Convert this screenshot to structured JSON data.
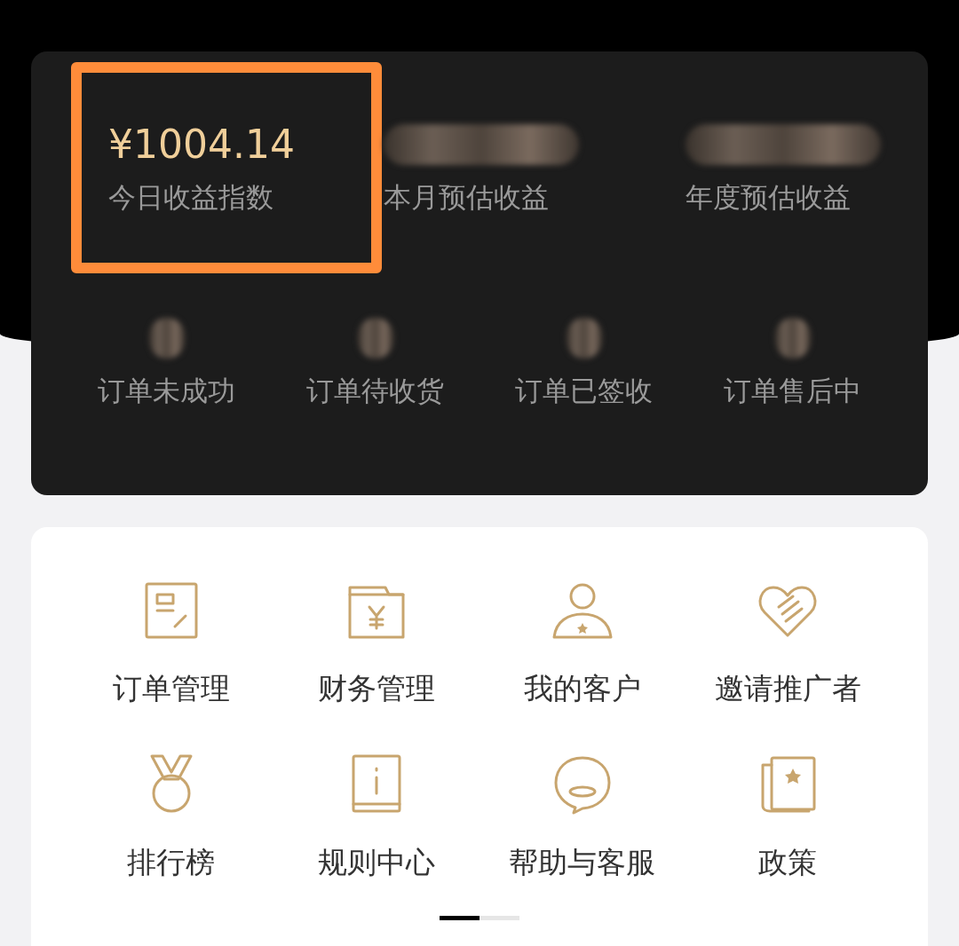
{
  "summary": {
    "stats": [
      {
        "value": "¥1004.14",
        "label": "今日收益指数",
        "highlighted": true
      },
      {
        "label": "本月预估收益",
        "highlighted": false
      },
      {
        "label": "年度预估收益",
        "highlighted": false
      }
    ],
    "orders": [
      {
        "label": "订单未成功"
      },
      {
        "label": "订单待收货"
      },
      {
        "label": "订单已签收"
      },
      {
        "label": "订单售后中"
      }
    ]
  },
  "menu": {
    "items": [
      {
        "label": "订单管理"
      },
      {
        "label": "财务管理"
      },
      {
        "label": "我的客户"
      },
      {
        "label": "邀请推广者"
      },
      {
        "label": "排行榜"
      },
      {
        "label": "规则中心"
      },
      {
        "label": "帮助与客服"
      },
      {
        "label": "政策"
      }
    ]
  },
  "pager": {
    "pages": [
      {
        "selected": true
      },
      {
        "selected": false
      }
    ]
  }
}
